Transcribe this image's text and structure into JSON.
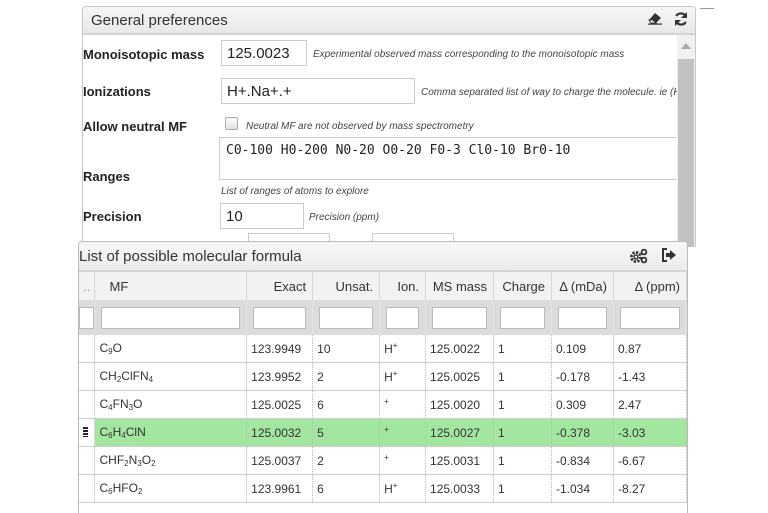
{
  "preferences": {
    "title": "General preferences",
    "icons": [
      "eraser-icon",
      "refresh-icon"
    ],
    "fields": {
      "monoisotopic_mass": {
        "label": "Monoisotopic mass",
        "value": "125.0023",
        "hint": "Experimental observed mass corresponding to the monoisotopic mass"
      },
      "ionizations": {
        "label": "Ionizations",
        "value": "H+.Na+.+",
        "hint": "Comma separated list of way to charge the molecule. ie (H"
      },
      "allow_neutral": {
        "label": "Allow neutral MF",
        "checked": false,
        "hint": "Neutral MF are not observed by mass spectrometry"
      },
      "ranges": {
        "label": "Ranges",
        "value": "C0-100 H0-200 N0-20 O0-20 F0-3 Cl0-10 Br0-10",
        "hint": "List of ranges of atoms to explore"
      },
      "precision": {
        "label": "Precision",
        "value": "10",
        "hint": "Precision (ppm)"
      }
    }
  },
  "results": {
    "title": "List of possible molecular formula",
    "icons": [
      "settings-gears-icon",
      "export-icon"
    ],
    "columns": [
      "..",
      "MF",
      "Exact",
      "Unsat.",
      "Ion.",
      "MS mass",
      "Charge",
      "Δ (mDa)",
      "Δ (ppm)"
    ],
    "rows": [
      {
        "mf_html": "C<sub>9</sub>O",
        "exact": "123.9949",
        "unsat": "10",
        "ion_html": "H<sup>+</sup>",
        "ms_mass": "125.0022",
        "charge": "1",
        "d_mda": "0.109",
        "d_ppm": "0.87",
        "selected": false
      },
      {
        "mf_html": "CH<sub>2</sub>ClFN<sub>4</sub>",
        "exact": "123.9952",
        "unsat": "2",
        "ion_html": "H<sup>+</sup>",
        "ms_mass": "125.0025",
        "charge": "1",
        "d_mda": "-0.178",
        "d_ppm": "-1.43",
        "selected": false
      },
      {
        "mf_html": "C<sub>4</sub>FN<sub>3</sub>O",
        "exact": "125.0025",
        "unsat": "6",
        "ion_html": "<sup>+</sup>",
        "ms_mass": "125.0020",
        "charge": "1",
        "d_mda": "0.309",
        "d_ppm": "2.47",
        "selected": false
      },
      {
        "mf_html": "C<sub>6</sub>H<sub>4</sub>ClN",
        "exact": "125.0032",
        "unsat": "5",
        "ion_html": "<sup>+</sup>",
        "ms_mass": "125.0027",
        "charge": "1",
        "d_mda": "-0.378",
        "d_ppm": "-3.03",
        "selected": true
      },
      {
        "mf_html": "CHF<sub>2</sub>N<sub>3</sub>O<sub>2</sub>",
        "exact": "125.0037",
        "unsat": "2",
        "ion_html": "<sup>+</sup>",
        "ms_mass": "125.0031",
        "charge": "1",
        "d_mda": "-0.834",
        "d_ppm": "-6.67",
        "selected": false
      },
      {
        "mf_html": "C<sub>6</sub>HFO<sub>2</sub>",
        "exact": "123.9961",
        "unsat": "6",
        "ion_html": "H<sup>+</sup>",
        "ms_mass": "125.0033",
        "charge": "1",
        "d_mda": "-1.034",
        "d_ppm": "-8.27",
        "selected": false
      }
    ]
  },
  "colors": {
    "selected_row": "#a2e6a0"
  }
}
